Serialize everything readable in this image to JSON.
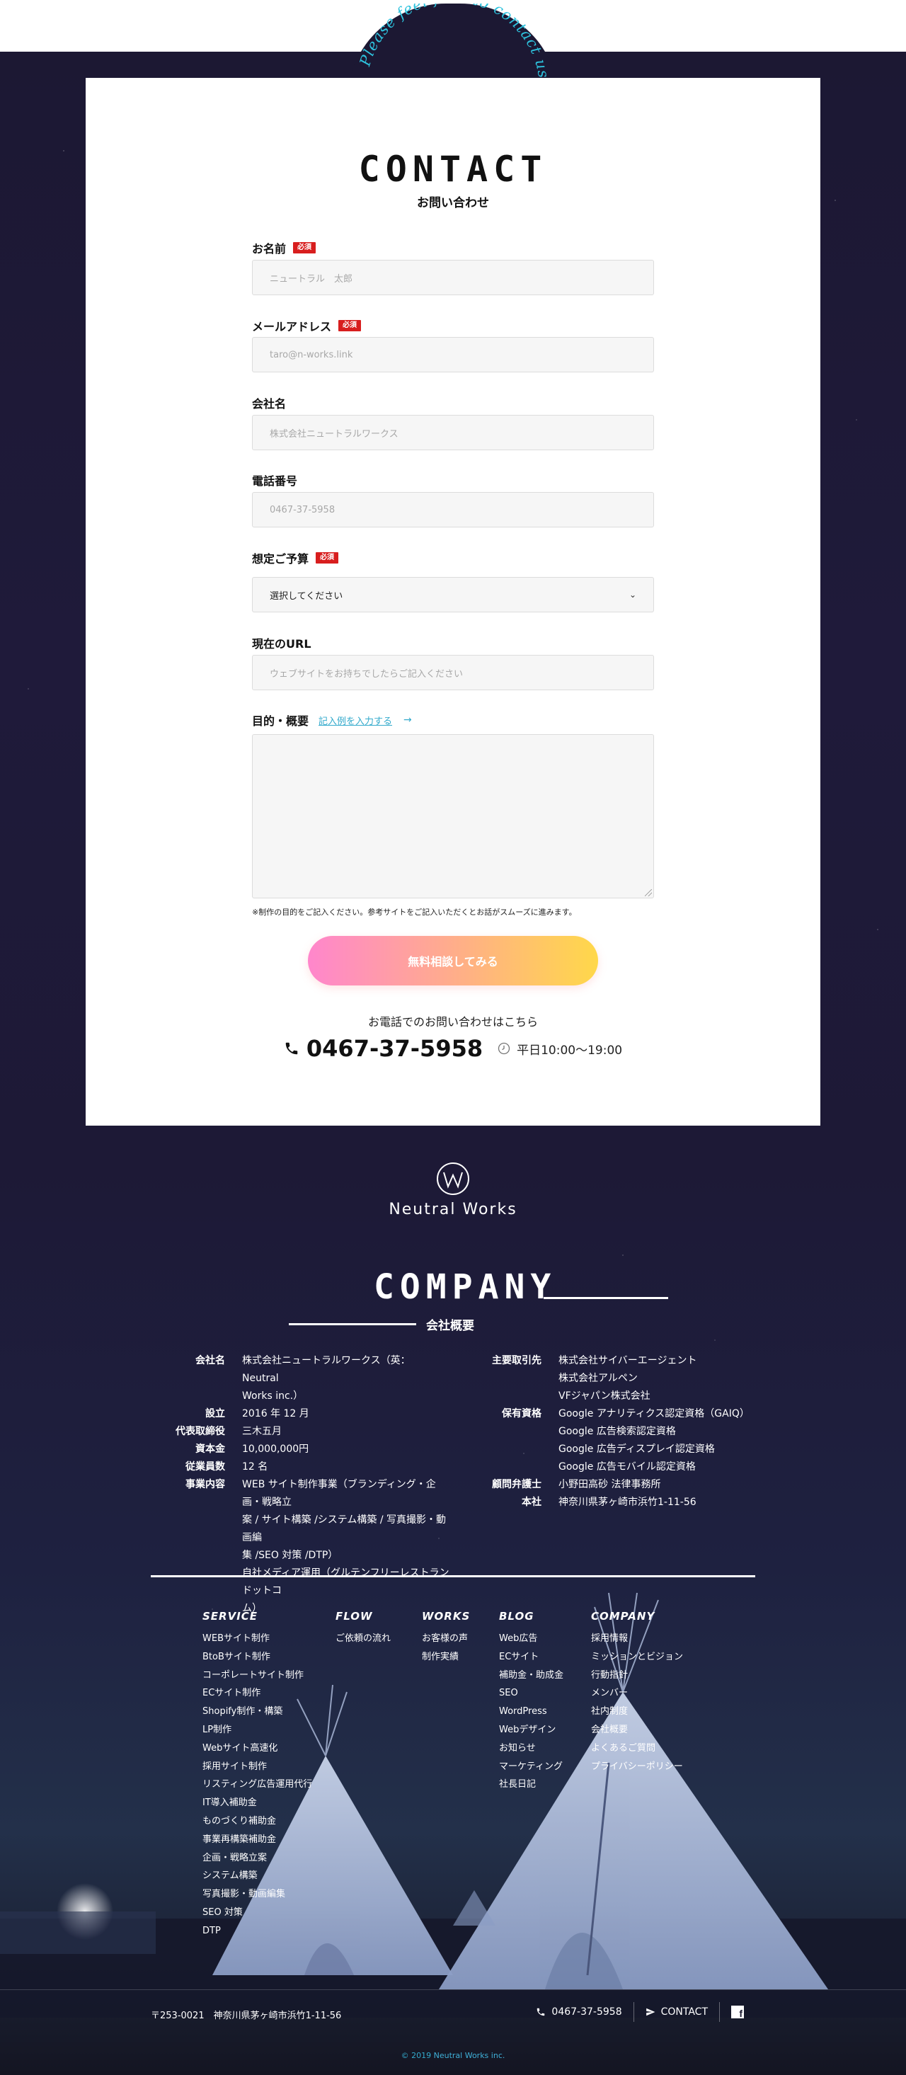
{
  "arch": {
    "tagline": "Please feel free to contact us!"
  },
  "contact": {
    "title": "CONTACT",
    "subtitle": "お問い合わせ",
    "required_badge": "必須",
    "fields": {
      "name": {
        "label": "お名前",
        "placeholder": "ニュートラル　太郎"
      },
      "email": {
        "label": "メールアドレス",
        "placeholder": "taro@n-works.link"
      },
      "company": {
        "label": "会社名",
        "placeholder": "株式会社ニュートラルワークス"
      },
      "phone": {
        "label": "電話番号",
        "placeholder": "0467-37-5958"
      },
      "budget": {
        "label": "想定ご予算",
        "selected": "選択してください"
      },
      "url": {
        "label": "現在のURL",
        "placeholder": "ウェブサイトをお持ちでしたらご記入ください"
      },
      "purpose": {
        "label": "目的・概要",
        "example_link": "記入例を入力する",
        "example_arrow": "→"
      }
    },
    "note": "※制作の目的をご記入ください。参考サイトをご記入いただくとお話がスムーズに進みます。",
    "submit_label": "無料相談してみる",
    "phone_intro": "お電話でのお問い合わせはこちら",
    "phone_number": "0467-37-5958",
    "hours": "平日10:00〜19:00"
  },
  "logo": {
    "name": "Neutral Works"
  },
  "company": {
    "title": "COMPANY",
    "subtitle": "会社概要",
    "left": [
      {
        "k": "会社名",
        "v": [
          "株式会社ニュートラルワークス（英：Neutral",
          "Works inc.）"
        ]
      },
      {
        "k": "設立",
        "v": [
          "2016 年 12 月"
        ]
      },
      {
        "k": "代表取締役",
        "v": [
          "三木五月"
        ]
      },
      {
        "k": "資本金",
        "v": [
          "10,000,000円"
        ]
      },
      {
        "k": "従業員数",
        "v": [
          "12 名"
        ]
      },
      {
        "k": "事業内容",
        "v": [
          "WEB サイト制作事業（ブランディング・企画・戦略立",
          "案 / サイト構築 /システム構築 / 写真撮影・動画編",
          "集 /SEO 対策 /DTP）",
          "自社メディア運用（グルテンフリーレストランドットコ",
          "ム）"
        ]
      }
    ],
    "right": [
      {
        "k": "主要取引先",
        "v": [
          "株式会社サイバーエージェント",
          "株式会社アルペン",
          "VFジャパン株式会社"
        ]
      },
      {
        "k": "保有資格",
        "v": [
          "Google アナリティクス認定資格（GAIQ）",
          "Google 広告検索認定資格",
          "Google 広告ディスプレイ認定資格",
          "Google 広告モバイル認定資格"
        ]
      },
      {
        "k": "顧問弁護士",
        "v": [
          "小野田高砂 法律事務所"
        ]
      },
      {
        "k": "本社",
        "v": [
          "神奈川県茅ヶ崎市浜竹1-11-56"
        ]
      }
    ]
  },
  "nav": [
    {
      "head": "SERVICE",
      "items": [
        "WEBサイト制作",
        "BtoBサイト制作",
        "コーポレートサイト制作",
        "ECサイト制作",
        "Shopify制作・構築",
        "LP制作",
        "Webサイト高速化",
        "採用サイト制作",
        "リスティング広告運用代行",
        "IT導入補助金",
        "ものづくり補助金",
        "事業再構築補助金",
        "企画・戦略立案",
        "システム構築",
        "写真撮影・動画編集",
        "SEO 対策",
        "DTP"
      ]
    },
    {
      "head": "FLOW",
      "items": [
        "ご依頼の流れ"
      ]
    },
    {
      "head": "WORKS",
      "items": [
        "お客様の声",
        "制作実績"
      ]
    },
    {
      "head": "BLOG",
      "items": [
        "Web広告",
        "ECサイト",
        "補助金・助成金",
        "SEO",
        "WordPress",
        "Webデザイン",
        "お知らせ",
        "マーケティング",
        "社長日記"
      ]
    },
    {
      "head": "COMPANY",
      "items": [
        "採用情報",
        "ミッションとビジョン",
        "行動指針",
        "メンバー",
        "社内制度",
        "会社概要",
        "よくあるご質問",
        "プライバシーポリシー"
      ]
    }
  ],
  "footer": {
    "address": "〒253-0021　神奈川県茅ヶ崎市浜竹1-11-56",
    "phone": "0467-37-5958",
    "contact_label": "CONTACT",
    "facebook_glyph": "f",
    "copyright_prefix": "© 2019 ",
    "copyright_brand": "Neutral Works inc."
  },
  "colors": {
    "accent_cyan": "#33aacc",
    "required_red": "#d81e1e",
    "cta_gradient_start": "#ff86cc",
    "cta_gradient_end": "#ffd84a",
    "night_bg": "#1e1a38"
  }
}
